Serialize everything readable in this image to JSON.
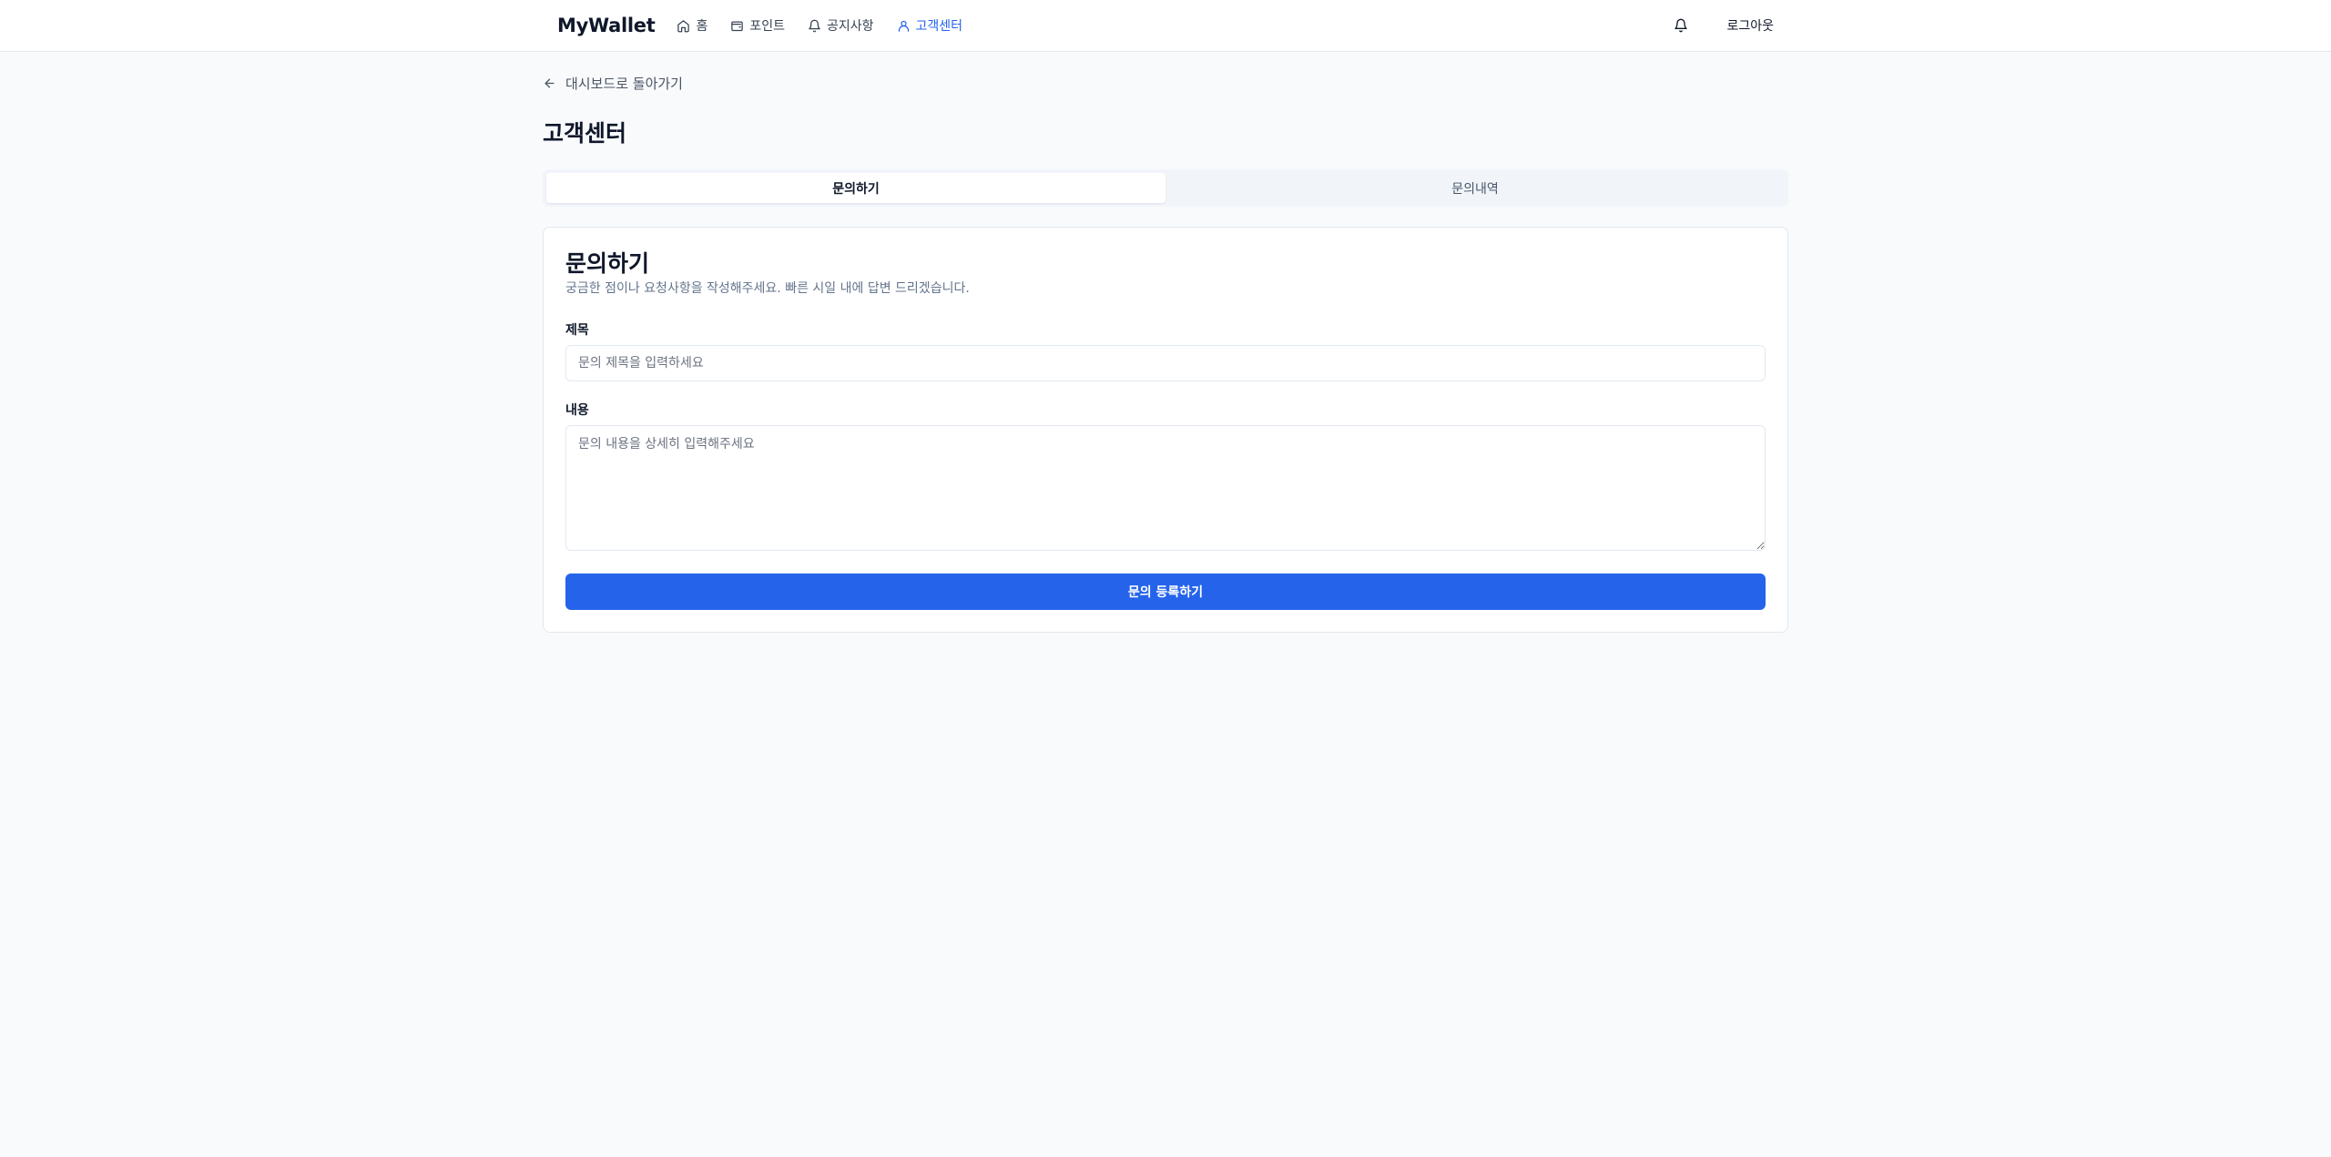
{
  "header": {
    "logo": "MyWallet",
    "nav": [
      {
        "label": "홈",
        "icon": "home-icon"
      },
      {
        "label": "포인트",
        "icon": "wallet-icon"
      },
      {
        "label": "공지사항",
        "icon": "bell-icon"
      },
      {
        "label": "고객센터",
        "icon": "user-icon",
        "active": true
      }
    ],
    "notification_icon": "bell-icon",
    "logout_label": "로그아웃"
  },
  "main": {
    "back_label": "대시보드로 돌아가기",
    "page_title": "고객센터",
    "tabs": [
      {
        "label": "문의하기",
        "active": true
      },
      {
        "label": "문의내역",
        "active": false
      }
    ],
    "form": {
      "title": "문의하기",
      "description": "궁금한 점이나 요청사항을 작성해주세요. 빠른 시일 내에 답변 드리겠습니다.",
      "subject_label": "제목",
      "subject_placeholder": "문의 제목을 입력하세요",
      "content_label": "내용",
      "content_placeholder": "문의 내용을 상세히 입력해주세요",
      "submit_label": "문의 등록하기"
    }
  },
  "colors": {
    "accent": "#2563eb",
    "background": "#f8fafc"
  }
}
